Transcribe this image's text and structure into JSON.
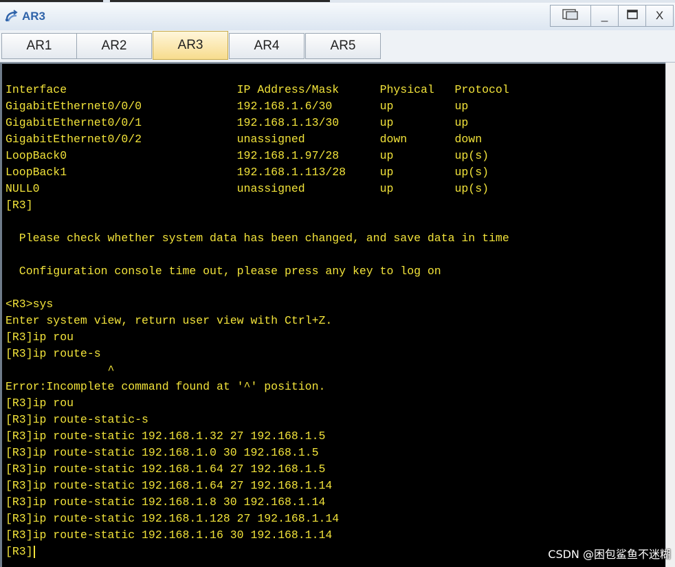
{
  "window": {
    "title": "AR3",
    "icon": "router-icon",
    "controls": {
      "restore": "restore-icon",
      "minimize": "_",
      "maximize": "maximize-icon",
      "close": "X"
    }
  },
  "tabs": [
    {
      "label": "AR1",
      "active": false
    },
    {
      "label": "AR2",
      "active": false
    },
    {
      "label": "AR3",
      "active": true
    },
    {
      "label": "AR4",
      "active": false
    },
    {
      "label": "AR5",
      "active": false
    }
  ],
  "terminal": {
    "text_color": "#f2e33a",
    "background": "#000000",
    "lines": [
      "Interface                         IP Address/Mask      Physical   Protocol",
      "GigabitEthernet0/0/0              192.168.1.6/30       up         up",
      "GigabitEthernet0/0/1              192.168.1.13/30      up         up",
      "GigabitEthernet0/0/2              unassigned           down       down",
      "LoopBack0                         192.168.1.97/28      up         up(s)",
      "LoopBack1                         192.168.1.113/28     up         up(s)",
      "NULL0                             unassigned           up         up(s)",
      "[R3]",
      "",
      "  Please check whether system data has been changed, and save data in time",
      "",
      "  Configuration console time out, please press any key to log on",
      "",
      "<R3>sys",
      "Enter system view, return user view with Ctrl+Z.",
      "[R3]ip rou",
      "[R3]ip route-s",
      "               ^",
      "Error:Incomplete command found at '^' position.",
      "[R3]ip rou",
      "[R3]ip route-static-s",
      "[R3]ip route-static 192.168.1.32 27 192.168.1.5",
      "[R3]ip route-static 192.168.1.0 30 192.168.1.5",
      "[R3]ip route-static 192.168.1.64 27 192.168.1.5",
      "[R3]ip route-static 192.168.1.64 27 192.168.1.14",
      "[R3]ip route-static 192.168.1.8 30 192.168.1.14",
      "[R3]ip route-static 192.168.1.128 27 192.168.1.14",
      "[R3]ip route-static 192.168.1.16 30 192.168.1.14",
      "[R3]"
    ]
  },
  "watermark": "CSDN @困包鲨鱼不迷糊"
}
